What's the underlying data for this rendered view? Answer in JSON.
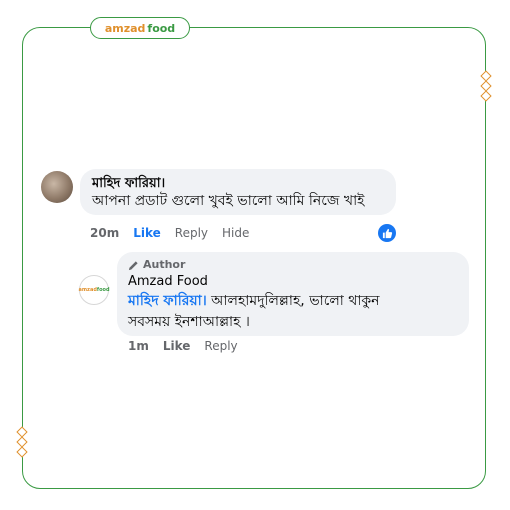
{
  "brand": {
    "part1": "amzad",
    "part2": "food"
  },
  "colors": {
    "frame": "#3a9a43",
    "accent": "#e0902c",
    "link": "#1877f2"
  },
  "comment": {
    "author": "মাহিদ ফারিয়া।",
    "text": "আপনা প্রডাট গুলো খুবই ভালো আমি নিজে খাই",
    "time": "20m",
    "like_label": "Like",
    "reply_label": "Reply",
    "hide_label": "Hide",
    "reaction_icon": "thumbs-up-icon"
  },
  "reply": {
    "badge": "Author",
    "author": "Amzad Food",
    "mention": "মাহিদ ফারিয়া।",
    "text_line1": " আলহামদুলিল্লাহ, ভালো থাকুন",
    "text_line2": "সবসময় ইনশাআল্লাহ ।",
    "time": "1m",
    "like_label": "Like",
    "reply_label": "Reply",
    "avatar_brand": {
      "part1": "amzad",
      "part2": "food"
    }
  }
}
